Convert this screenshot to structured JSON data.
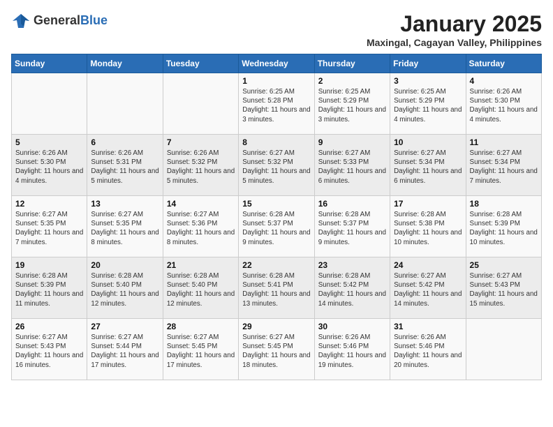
{
  "header": {
    "logo_general": "General",
    "logo_blue": "Blue",
    "title": "January 2025",
    "location": "Maxingal, Cagayan Valley, Philippines"
  },
  "weekdays": [
    "Sunday",
    "Monday",
    "Tuesday",
    "Wednesday",
    "Thursday",
    "Friday",
    "Saturday"
  ],
  "weeks": [
    [
      {
        "day": "",
        "sunrise": "",
        "sunset": "",
        "daylight": ""
      },
      {
        "day": "",
        "sunrise": "",
        "sunset": "",
        "daylight": ""
      },
      {
        "day": "",
        "sunrise": "",
        "sunset": "",
        "daylight": ""
      },
      {
        "day": "1",
        "sunrise": "Sunrise: 6:25 AM",
        "sunset": "Sunset: 5:28 PM",
        "daylight": "Daylight: 11 hours and 3 minutes."
      },
      {
        "day": "2",
        "sunrise": "Sunrise: 6:25 AM",
        "sunset": "Sunset: 5:29 PM",
        "daylight": "Daylight: 11 hours and 3 minutes."
      },
      {
        "day": "3",
        "sunrise": "Sunrise: 6:25 AM",
        "sunset": "Sunset: 5:29 PM",
        "daylight": "Daylight: 11 hours and 4 minutes."
      },
      {
        "day": "4",
        "sunrise": "Sunrise: 6:26 AM",
        "sunset": "Sunset: 5:30 PM",
        "daylight": "Daylight: 11 hours and 4 minutes."
      }
    ],
    [
      {
        "day": "5",
        "sunrise": "Sunrise: 6:26 AM",
        "sunset": "Sunset: 5:30 PM",
        "daylight": "Daylight: 11 hours and 4 minutes."
      },
      {
        "day": "6",
        "sunrise": "Sunrise: 6:26 AM",
        "sunset": "Sunset: 5:31 PM",
        "daylight": "Daylight: 11 hours and 5 minutes."
      },
      {
        "day": "7",
        "sunrise": "Sunrise: 6:26 AM",
        "sunset": "Sunset: 5:32 PM",
        "daylight": "Daylight: 11 hours and 5 minutes."
      },
      {
        "day": "8",
        "sunrise": "Sunrise: 6:27 AM",
        "sunset": "Sunset: 5:32 PM",
        "daylight": "Daylight: 11 hours and 5 minutes."
      },
      {
        "day": "9",
        "sunrise": "Sunrise: 6:27 AM",
        "sunset": "Sunset: 5:33 PM",
        "daylight": "Daylight: 11 hours and 6 minutes."
      },
      {
        "day": "10",
        "sunrise": "Sunrise: 6:27 AM",
        "sunset": "Sunset: 5:34 PM",
        "daylight": "Daylight: 11 hours and 6 minutes."
      },
      {
        "day": "11",
        "sunrise": "Sunrise: 6:27 AM",
        "sunset": "Sunset: 5:34 PM",
        "daylight": "Daylight: 11 hours and 7 minutes."
      }
    ],
    [
      {
        "day": "12",
        "sunrise": "Sunrise: 6:27 AM",
        "sunset": "Sunset: 5:35 PM",
        "daylight": "Daylight: 11 hours and 7 minutes."
      },
      {
        "day": "13",
        "sunrise": "Sunrise: 6:27 AM",
        "sunset": "Sunset: 5:35 PM",
        "daylight": "Daylight: 11 hours and 8 minutes."
      },
      {
        "day": "14",
        "sunrise": "Sunrise: 6:27 AM",
        "sunset": "Sunset: 5:36 PM",
        "daylight": "Daylight: 11 hours and 8 minutes."
      },
      {
        "day": "15",
        "sunrise": "Sunrise: 6:28 AM",
        "sunset": "Sunset: 5:37 PM",
        "daylight": "Daylight: 11 hours and 9 minutes."
      },
      {
        "day": "16",
        "sunrise": "Sunrise: 6:28 AM",
        "sunset": "Sunset: 5:37 PM",
        "daylight": "Daylight: 11 hours and 9 minutes."
      },
      {
        "day": "17",
        "sunrise": "Sunrise: 6:28 AM",
        "sunset": "Sunset: 5:38 PM",
        "daylight": "Daylight: 11 hours and 10 minutes."
      },
      {
        "day": "18",
        "sunrise": "Sunrise: 6:28 AM",
        "sunset": "Sunset: 5:39 PM",
        "daylight": "Daylight: 11 hours and 10 minutes."
      }
    ],
    [
      {
        "day": "19",
        "sunrise": "Sunrise: 6:28 AM",
        "sunset": "Sunset: 5:39 PM",
        "daylight": "Daylight: 11 hours and 11 minutes."
      },
      {
        "day": "20",
        "sunrise": "Sunrise: 6:28 AM",
        "sunset": "Sunset: 5:40 PM",
        "daylight": "Daylight: 11 hours and 12 minutes."
      },
      {
        "day": "21",
        "sunrise": "Sunrise: 6:28 AM",
        "sunset": "Sunset: 5:40 PM",
        "daylight": "Daylight: 11 hours and 12 minutes."
      },
      {
        "day": "22",
        "sunrise": "Sunrise: 6:28 AM",
        "sunset": "Sunset: 5:41 PM",
        "daylight": "Daylight: 11 hours and 13 minutes."
      },
      {
        "day": "23",
        "sunrise": "Sunrise: 6:28 AM",
        "sunset": "Sunset: 5:42 PM",
        "daylight": "Daylight: 11 hours and 14 minutes."
      },
      {
        "day": "24",
        "sunrise": "Sunrise: 6:27 AM",
        "sunset": "Sunset: 5:42 PM",
        "daylight": "Daylight: 11 hours and 14 minutes."
      },
      {
        "day": "25",
        "sunrise": "Sunrise: 6:27 AM",
        "sunset": "Sunset: 5:43 PM",
        "daylight": "Daylight: 11 hours and 15 minutes."
      }
    ],
    [
      {
        "day": "26",
        "sunrise": "Sunrise: 6:27 AM",
        "sunset": "Sunset: 5:43 PM",
        "daylight": "Daylight: 11 hours and 16 minutes."
      },
      {
        "day": "27",
        "sunrise": "Sunrise: 6:27 AM",
        "sunset": "Sunset: 5:44 PM",
        "daylight": "Daylight: 11 hours and 17 minutes."
      },
      {
        "day": "28",
        "sunrise": "Sunrise: 6:27 AM",
        "sunset": "Sunset: 5:45 PM",
        "daylight": "Daylight: 11 hours and 17 minutes."
      },
      {
        "day": "29",
        "sunrise": "Sunrise: 6:27 AM",
        "sunset": "Sunset: 5:45 PM",
        "daylight": "Daylight: 11 hours and 18 minutes."
      },
      {
        "day": "30",
        "sunrise": "Sunrise: 6:26 AM",
        "sunset": "Sunset: 5:46 PM",
        "daylight": "Daylight: 11 hours and 19 minutes."
      },
      {
        "day": "31",
        "sunrise": "Sunrise: 6:26 AM",
        "sunset": "Sunset: 5:46 PM",
        "daylight": "Daylight: 11 hours and 20 minutes."
      },
      {
        "day": "",
        "sunrise": "",
        "sunset": "",
        "daylight": ""
      }
    ]
  ]
}
